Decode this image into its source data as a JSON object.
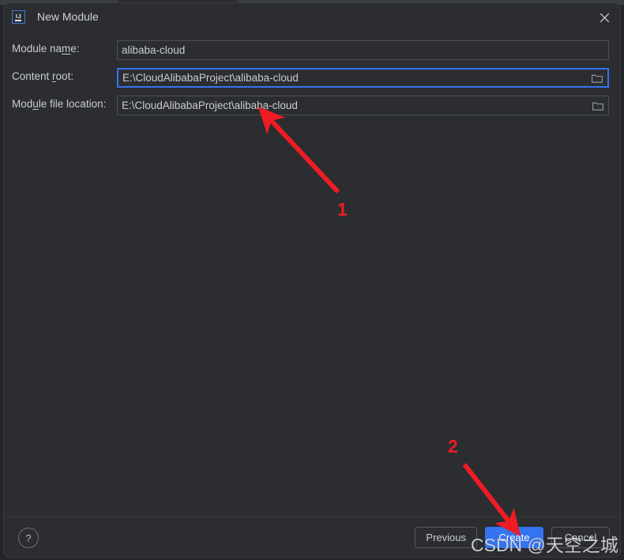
{
  "window": {
    "title": "New Module",
    "app_icon": "intellij-idea-icon",
    "close_icon": "close-icon"
  },
  "form": {
    "fields": [
      {
        "label_pre": "Module na",
        "label_mnemonic": "m",
        "label_post": "e:",
        "value": "alibaba-cloud",
        "focused": false,
        "has_browse": false,
        "name": "module-name"
      },
      {
        "label_pre": "Content ",
        "label_mnemonic": "r",
        "label_post": "oot:",
        "value": "E:\\CloudAlibabaProject\\alibaba-cloud",
        "focused": true,
        "has_browse": true,
        "name": "content-root"
      },
      {
        "label_pre": "Mod",
        "label_mnemonic": "u",
        "label_post": "le file location:",
        "value": "E:\\CloudAlibabaProject\\alibaba-cloud",
        "focused": false,
        "has_browse": true,
        "name": "module-file-location"
      }
    ]
  },
  "footer": {
    "help_label": "?",
    "previous_label": "Previous",
    "create_label": "Create",
    "cancel_label": "Cancel"
  },
  "annotations": {
    "marker_1": "1",
    "marker_2": "2",
    "arrow_color": "#ee1c24"
  },
  "watermark": {
    "prefix": "CSDN",
    "at": " @",
    "suffix": "天空之城"
  },
  "colors": {
    "dialog_bg": "#2b2d30",
    "accent_blue": "#3574f0",
    "focus_border": "#3574f0",
    "text": "#c9ccd2",
    "field_border": "#4c5053",
    "annotation_red": "#ee1c24"
  }
}
